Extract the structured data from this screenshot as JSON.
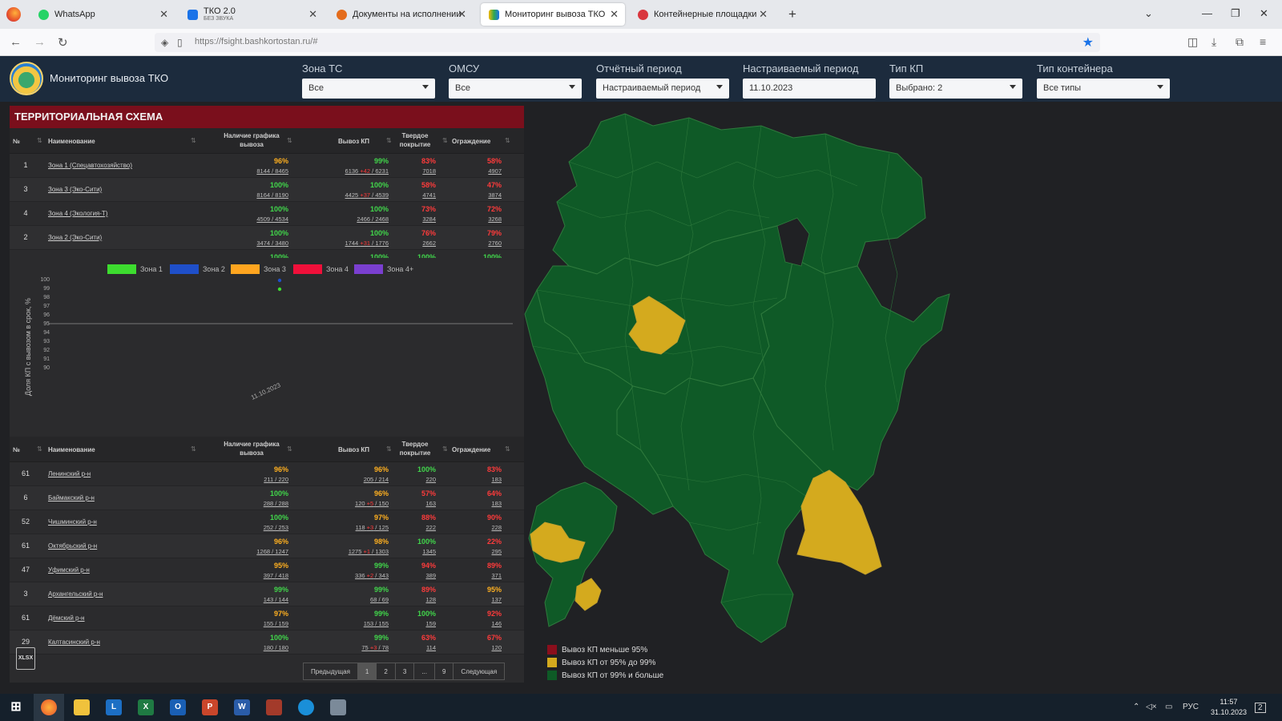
{
  "browser": {
    "tabs": [
      {
        "title": "WhatsApp",
        "sub": ""
      },
      {
        "title": "ТКО 2.0",
        "sub": "БЕЗ ЗВУКА"
      },
      {
        "title": "Документы на исполнении",
        "sub": ""
      },
      {
        "title": "Мониторинг вывоза ТКО",
        "sub": ""
      },
      {
        "title": "Контейнерные площадки",
        "sub": ""
      }
    ],
    "url": "https://fsight.bashkortostan.ru/#"
  },
  "header": {
    "title": "Мониторинг вывоза ТКО",
    "filters": [
      {
        "label": "Зона ТС",
        "value": "Все",
        "dropdown": true
      },
      {
        "label": "ОМСУ",
        "value": "Все",
        "dropdown": true
      },
      {
        "label": "Отчётный период",
        "value": "Настраиваемый период",
        "dropdown": true
      },
      {
        "label": "Настраиваемый период",
        "value": "11.10.2023",
        "dropdown": false
      },
      {
        "label": "Тип КП",
        "value": "Выбрано: 2",
        "dropdown": true
      },
      {
        "label": "Тип контейнера",
        "value": "Все типы",
        "dropdown": true
      }
    ]
  },
  "panel": {
    "title": "ТЕРРИТОРИАЛЬНАЯ СХЕМА",
    "columns": {
      "num": "№",
      "name": "Наименование",
      "schedule": "Наличие графика вывоза",
      "export": "Вывоз КП",
      "surface": "Твердое покрытие",
      "fence": "Ограждение"
    },
    "zones": [
      {
        "num": "1",
        "name": "Зона 1 (Спецавтохозяйство)",
        "schedule_pct": "96%",
        "schedule_sub": "8144 / 8465",
        "export_pct": "99%",
        "export_a": "6136",
        "export_red": "+42",
        "export_b": "6231",
        "surface_pct": "83%",
        "surface_sub": "7018",
        "fence_pct": "58%",
        "fence_sub": "4907",
        "colors": [
          "y",
          "g",
          "r",
          "r"
        ]
      },
      {
        "num": "3",
        "name": "Зона 3 (Эко-Сити)",
        "schedule_pct": "100%",
        "schedule_sub": "8164 / 8190",
        "export_pct": "100%",
        "export_a": "4425",
        "export_red": "+37",
        "export_b": "4539",
        "surface_pct": "58%",
        "surface_sub": "4741",
        "fence_pct": "47%",
        "fence_sub": "3874",
        "colors": [
          "g",
          "g",
          "r",
          "r"
        ]
      },
      {
        "num": "4",
        "name": "Зона 4 (Экология-Т)",
        "schedule_pct": "100%",
        "schedule_sub": "4509 / 4534",
        "export_pct": "100%",
        "export_a": "2466",
        "export_red": "",
        "export_b": "2468",
        "surface_pct": "73%",
        "surface_sub": "3284",
        "fence_pct": "72%",
        "fence_sub": "3268",
        "colors": [
          "g",
          "g",
          "r",
          "r"
        ]
      },
      {
        "num": "2",
        "name": "Зона 2 (Эко-Сити)",
        "schedule_pct": "100%",
        "schedule_sub": "3474 / 3480",
        "export_pct": "100%",
        "export_a": "1744",
        "export_red": "+31",
        "export_b": "1776",
        "surface_pct": "76%",
        "surface_sub": "2662",
        "fence_pct": "79%",
        "fence_sub": "2760",
        "colors": [
          "g",
          "g",
          "r",
          "r"
        ]
      },
      {
        "num": "5",
        "name": "",
        "schedule_pct": "100%",
        "schedule_sub": "",
        "export_pct": "100%",
        "export_a": "",
        "export_red": "",
        "export_b": "",
        "surface_pct": "100%",
        "surface_sub": "",
        "fence_pct": "100%",
        "fence_sub": "",
        "colors": [
          "g",
          "g",
          "g",
          "g"
        ]
      }
    ],
    "legend": [
      {
        "name": "Зона 1",
        "color": "#3ddc2f"
      },
      {
        "name": "Зона 2",
        "color": "#1f4fc9"
      },
      {
        "name": "Зона 3",
        "color": "#ffa51f"
      },
      {
        "name": "Зона 4",
        "color": "#f0103a"
      },
      {
        "name": "Зона 4+",
        "color": "#7a3fd0"
      }
    ],
    "chart_ylabel": "Доля КП с вывозом в срок, %",
    "chart_yticks": [
      "100",
      "99",
      "98",
      "97",
      "96",
      "95",
      "94",
      "93",
      "92",
      "91",
      "90"
    ],
    "chart_xtick": "11.10.2023",
    "districts": [
      {
        "num": "61",
        "name": "Ленинский р-н",
        "schedule_pct": "96%",
        "schedule_sub": "211 / 220",
        "export_pct": "96%",
        "export_a": "205",
        "export_red": "",
        "export_b": "214",
        "surface_pct": "100%",
        "surface_sub": "220",
        "fence_pct": "83%",
        "fence_sub": "183",
        "colors": [
          "y",
          "y",
          "g",
          "r"
        ]
      },
      {
        "num": "6",
        "name": "Баймакский р-н",
        "schedule_pct": "100%",
        "schedule_sub": "288 / 288",
        "export_pct": "96%",
        "export_a": "120",
        "export_red": "+5",
        "export_b": "150",
        "surface_pct": "57%",
        "surface_sub": "163",
        "fence_pct": "64%",
        "fence_sub": "183",
        "colors": [
          "g",
          "y",
          "r",
          "r"
        ]
      },
      {
        "num": "52",
        "name": "Чишминский р-н",
        "schedule_pct": "100%",
        "schedule_sub": "252 / 253",
        "export_pct": "97%",
        "export_a": "118",
        "export_red": "+3",
        "export_b": "125",
        "surface_pct": "88%",
        "surface_sub": "222",
        "fence_pct": "90%",
        "fence_sub": "228",
        "colors": [
          "g",
          "y",
          "r",
          "r"
        ]
      },
      {
        "num": "61",
        "name": "Октябрьский р-н",
        "schedule_pct": "96%",
        "schedule_sub": "1268 / 1247",
        "export_pct": "98%",
        "export_a": "1275",
        "export_red": "+1",
        "export_b": "1303",
        "surface_pct": "100%",
        "surface_sub": "1345",
        "fence_pct": "22%",
        "fence_sub": "295",
        "colors": [
          "y",
          "y",
          "g",
          "r"
        ]
      },
      {
        "num": "47",
        "name": "Уфимский р-н",
        "schedule_pct": "95%",
        "schedule_sub": "397 / 418",
        "export_pct": "99%",
        "export_a": "336",
        "export_red": "+2",
        "export_b": "343",
        "surface_pct": "94%",
        "surface_sub": "389",
        "fence_pct": "89%",
        "fence_sub": "371",
        "colors": [
          "y",
          "g",
          "r",
          "r"
        ]
      },
      {
        "num": "3",
        "name": "Архангельский р-н",
        "schedule_pct": "99%",
        "schedule_sub": "143 / 144",
        "export_pct": "99%",
        "export_a": "68",
        "export_red": "",
        "export_b": "69",
        "surface_pct": "89%",
        "surface_sub": "128",
        "fence_pct": "95%",
        "fence_sub": "137",
        "colors": [
          "g",
          "g",
          "r",
          "y"
        ]
      },
      {
        "num": "61",
        "name": "Дёмский р-н",
        "schedule_pct": "97%",
        "schedule_sub": "155 / 159",
        "export_pct": "99%",
        "export_a": "153",
        "export_red": "",
        "export_b": "155",
        "surface_pct": "100%",
        "surface_sub": "159",
        "fence_pct": "92%",
        "fence_sub": "146",
        "colors": [
          "y",
          "g",
          "g",
          "r"
        ]
      },
      {
        "num": "29",
        "name": "Калтасинский р-н",
        "schedule_pct": "100%",
        "schedule_sub": "180 / 180",
        "export_pct": "99%",
        "export_a": "75",
        "export_red": "+3",
        "export_b": "78",
        "surface_pct": "63%",
        "surface_sub": "114",
        "fence_pct": "67%",
        "fence_sub": "120",
        "colors": [
          "g",
          "g",
          "r",
          "r"
        ]
      }
    ],
    "pager": {
      "prev": "Предыдущая",
      "pages": [
        "1",
        "2",
        "3",
        "...",
        "9"
      ],
      "next": "Следующая"
    },
    "export_label": "XLSX"
  },
  "map": {
    "legend": [
      {
        "label": "Вывоз КП меньше 95%",
        "color": "#8a0f1c"
      },
      {
        "label": "Вывоз КП от 95% до 99%",
        "color": "#d4aa1e"
      },
      {
        "label": "Вывоз КП от 99% и больше",
        "color": "#0e5a26"
      }
    ]
  },
  "taskbar": {
    "lang": "РУС",
    "time": "11:57",
    "date": "31.10.2023",
    "notif": "2"
  }
}
